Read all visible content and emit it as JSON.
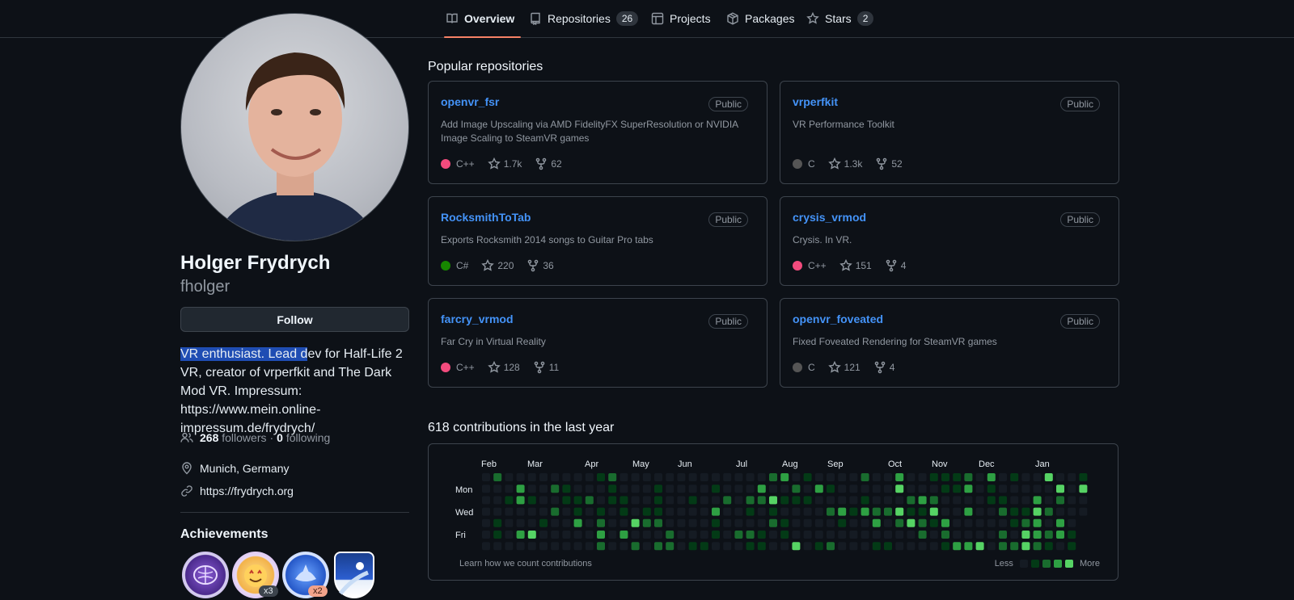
{
  "nav": {
    "tabs": [
      {
        "label": "Overview",
        "icon": "book-icon",
        "active": true
      },
      {
        "label": "Repositories",
        "icon": "repo-icon",
        "count": "26"
      },
      {
        "label": "Projects",
        "icon": "table-icon"
      },
      {
        "label": "Packages",
        "icon": "package-icon"
      },
      {
        "label": "Stars",
        "icon": "star-icon",
        "count": "2"
      }
    ]
  },
  "profile": {
    "name": "Holger Frydrych",
    "login": "fholger",
    "follow_label": "Follow",
    "bio_selected": "VR enthusiast. Lead d",
    "bio_rest": "ev for Half-Life 2 VR, creator of vrperfkit and The Dark Mod VR. Impressum: https://www.mein.online-impressum.de/frydrych/",
    "followers_count": "268",
    "followers_label": "followers",
    "separator": "·",
    "following_count": "0",
    "following_label": "following",
    "location": "Munich, Germany",
    "website": "https://frydrych.org",
    "achievements_title": "Achievements",
    "achievements": [
      {
        "icon": "galaxy-brain-icon",
        "multiplier": ""
      },
      {
        "icon": "starstruck-icon",
        "multiplier": "x3"
      },
      {
        "icon": "pull-shark-icon",
        "multiplier": "x2"
      },
      {
        "icon": "arctic-code-vault-icon",
        "multiplier": ""
      }
    ]
  },
  "popular": {
    "title": "Popular repositories",
    "repos": [
      {
        "name": "openvr_fsr",
        "visibility": "Public",
        "description": "Add Image Upscaling via AMD FidelityFX SuperResolution or NVIDIA Image Scaling to SteamVR games",
        "language": "C++",
        "lang_color": "#f34b7d",
        "stars": "1.7k",
        "forks": "62"
      },
      {
        "name": "vrperfkit",
        "visibility": "Public",
        "description": "VR Performance Toolkit",
        "language": "C",
        "lang_color": "#555555",
        "stars": "1.3k",
        "forks": "52"
      },
      {
        "name": "RocksmithToTab",
        "visibility": "Public",
        "description": "Exports Rocksmith 2014 songs to Guitar Pro tabs",
        "language": "C#",
        "lang_color": "#178600",
        "stars": "220",
        "forks": "36"
      },
      {
        "name": "crysis_vrmod",
        "visibility": "Public",
        "description": "Crysis. In VR.",
        "language": "C++",
        "lang_color": "#f34b7d",
        "stars": "151",
        "forks": "4"
      },
      {
        "name": "farcry_vrmod",
        "visibility": "Public",
        "description": "Far Cry in Virtual Reality",
        "language": "C++",
        "lang_color": "#f34b7d",
        "stars": "128",
        "forks": "11"
      },
      {
        "name": "openvr_foveated",
        "visibility": "Public",
        "description": "Fixed Foveated Rendering for SteamVR games",
        "language": "C",
        "lang_color": "#555555",
        "stars": "121",
        "forks": "4"
      }
    ]
  },
  "contributions": {
    "title": "618 contributions in the last year",
    "months": [
      "Feb",
      "Mar",
      "Apr",
      "May",
      "Jun",
      "Jul",
      "Aug",
      "Sep",
      "Oct",
      "Nov",
      "Dec",
      "Jan"
    ],
    "days": [
      "Mon",
      "Wed",
      "Fri"
    ],
    "learn_label": "Learn how we count contributions",
    "legend_less": "Less",
    "legend_more": "More",
    "level_colors": [
      "#151b23",
      "#033a16",
      "#196c2e",
      "#2ea043",
      "#56d364"
    ]
  }
}
